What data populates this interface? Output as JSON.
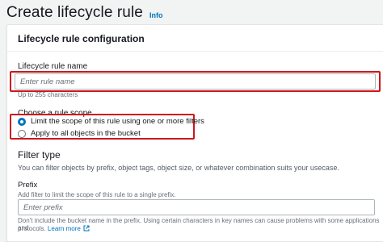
{
  "header": {
    "title": "Create lifecycle rule",
    "info_link": "Info"
  },
  "panel": {
    "title": "Lifecycle rule configuration"
  },
  "rule_name": {
    "label": "Lifecycle rule name",
    "placeholder": "Enter rule name",
    "value": "",
    "constraint": "Up to 255 characters"
  },
  "scope": {
    "label": "Choose a rule scope",
    "options": [
      {
        "label": "Limit the scope of this rule using one or more filters",
        "selected": true
      },
      {
        "label": "Apply to all objects in the bucket",
        "selected": false
      }
    ]
  },
  "filter": {
    "title": "Filter type",
    "description": "You can filter objects by prefix, object tags, object size, or whatever combination suits your usecase.",
    "prefix_label": "Prefix",
    "prefix_description": "Add filter to limit the scope of this rule to a single prefix.",
    "prefix_placeholder": "Enter prefix",
    "prefix_value": "",
    "prefix_hint_line1": "Don't include the bucket name in the prefix. Using certain characters in key names can cause problems with some applications and",
    "prefix_hint_line2": "protocols.",
    "learn_more": "Learn more"
  },
  "colors": {
    "accent": "#0073bb",
    "highlight_border": "#d0151b"
  },
  "icons": {
    "external_link": "external-link-icon"
  }
}
